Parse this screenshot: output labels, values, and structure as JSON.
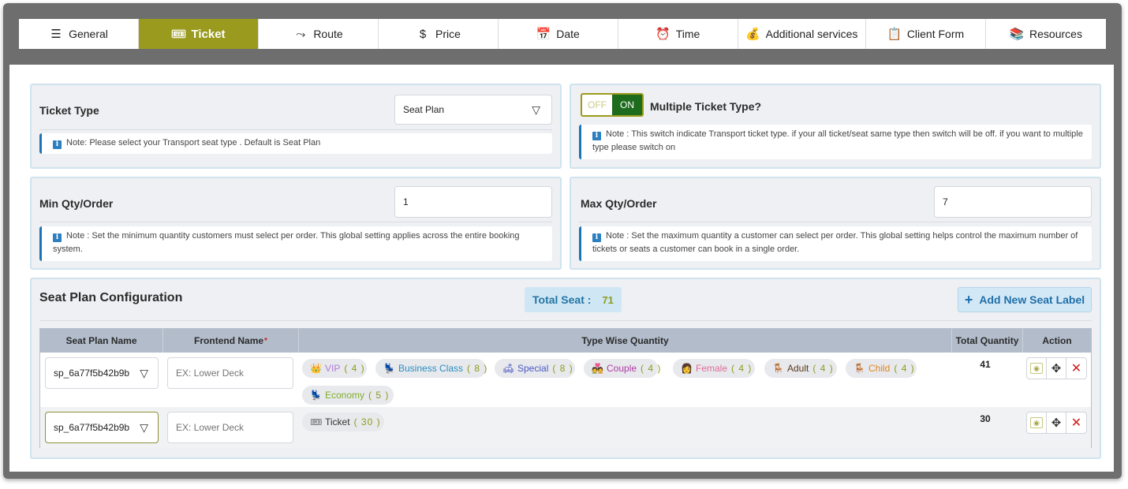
{
  "tabs": [
    {
      "label": "General",
      "icon": "rainbow-icon",
      "glyph": "☰"
    },
    {
      "label": "Ticket",
      "icon": "ticket-icon",
      "glyph": "🎟",
      "active": true
    },
    {
      "label": "Route",
      "icon": "route-icon",
      "glyph": "⤳"
    },
    {
      "label": "Price",
      "icon": "dollar-icon",
      "glyph": "$"
    },
    {
      "label": "Date",
      "icon": "calendar-icon",
      "glyph": "📅"
    },
    {
      "label": "Time",
      "icon": "alarm-clock-icon",
      "glyph": "⏰"
    },
    {
      "label": "Additional services",
      "icon": "money-bag-icon",
      "glyph": "💰"
    },
    {
      "label": "Client Form",
      "icon": "clipboard-icon",
      "glyph": "📋"
    },
    {
      "label": "Resources",
      "icon": "books-icon",
      "glyph": "📚"
    }
  ],
  "ticket_type": {
    "label": "Ticket Type",
    "value": "Seat Plan",
    "note": "Note: Please select your Transport seat type . Default is Seat Plan"
  },
  "multiple_ticket": {
    "off_label": "OFF",
    "on_label": "ON",
    "label": "Multiple Ticket Type?",
    "note": "Note : This switch indicate Transport ticket type. if your all ticket/seat same type then switch will be off. if you want to multiple type please switch on"
  },
  "min_qty": {
    "label": "Min Qty/Order",
    "value": "1",
    "note": "Note : Set the minimum quantity customers must select per order. This global setting applies across the entire booking system."
  },
  "max_qty": {
    "label": "Max Qty/Order",
    "value": "7",
    "note": "Note : Set the maximum quantity a customer can select per order. This global setting helps control the maximum number of tickets or seats a customer can book in a single order."
  },
  "seat_plan": {
    "title": "Seat Plan Configuration",
    "total_label": "Total Seat :",
    "total_value": "71",
    "add_button": "Add New Seat Label",
    "columns": [
      "Seat Plan Name",
      "Frontend Name",
      "Type Wise Quantity",
      "Total Quantity",
      "Action"
    ],
    "frontend_placeholder": "EX: Lower Deck",
    "rows": [
      {
        "plan_name": "sp_6a77f5b42b9b",
        "total": "41",
        "chips": [
          {
            "name": "VIP",
            "qty": "( 4 )",
            "color": "#b07ad6",
            "icon": "crown-icon",
            "glyph": "👑"
          },
          {
            "name": "Business Class",
            "qty": "( 8 )",
            "color": "#2b8fc2",
            "icon": "business-seat-icon",
            "glyph": "💺"
          },
          {
            "name": "Special",
            "qty": "( 8 )",
            "color": "#4a58c4",
            "icon": "sofa-icon",
            "glyph": "🛋"
          },
          {
            "name": "Couple",
            "qty": "( 4 )",
            "color": "#b13aa8",
            "icon": "couple-icon",
            "glyph": "💑"
          },
          {
            "name": "Female",
            "qty": "( 4 )",
            "color": "#e26b9a",
            "icon": "female-icon",
            "glyph": "👩"
          },
          {
            "name": "Adult",
            "qty": "( 4 )",
            "color": "#5a3a1e",
            "icon": "chair-icon",
            "glyph": "🪑"
          },
          {
            "name": "Child",
            "qty": "( 4 )",
            "color": "#e0861e",
            "icon": "child-chair-icon",
            "glyph": "🪑"
          },
          {
            "name": "Economy",
            "qty": "( 5 )",
            "color": "#7fae2a",
            "icon": "economy-seat-icon",
            "glyph": "💺"
          }
        ]
      },
      {
        "plan_name": "sp_6a77f5b42b9b",
        "total": "30",
        "chips": [
          {
            "name": "Ticket",
            "qty": "( 30 )",
            "color": "#333333",
            "icon": "ticket-icon",
            "glyph": "🎟"
          }
        ]
      }
    ]
  },
  "colors": {
    "accent": "#999a1e",
    "toggle_on": "#1d6b1d",
    "note_border": "#1d74b4",
    "delete": "#d21d1d"
  }
}
